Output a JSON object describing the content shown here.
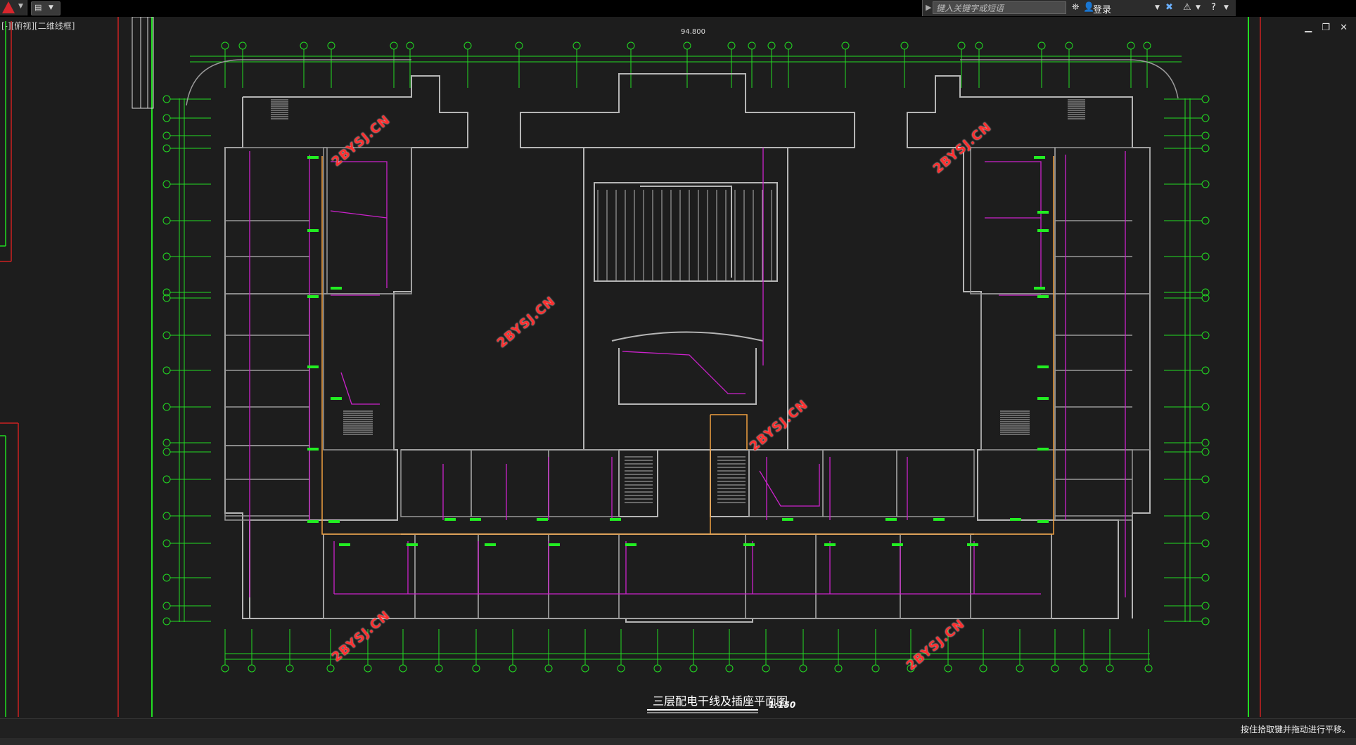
{
  "titlebar": {
    "search_placeholder": "键入关键字或短语",
    "login_label": "登录"
  },
  "viewport_label": "[-][俯视][二维线框]",
  "drawing": {
    "title": "三层配电干线及插座平面图",
    "scale": "1:150",
    "elevation": "94.800",
    "watermarks": [
      "2BYSJ.CN",
      "2BYSJ.CN",
      "2BYSJ.CN",
      "2BYSJ.CN",
      "2BYSJ.CN",
      "2BYSJ.CN",
      "2BYSJ.CN"
    ]
  },
  "status_message": "按住拾取键并拖动进行平移。",
  "colors": {
    "background": "#1d1d1d",
    "wall": "#b5b5b5",
    "grid_axis": "#22dd22",
    "power_line": "#cc22cc",
    "trunk_line": "#f0a040",
    "watermark": "#ff3030"
  }
}
